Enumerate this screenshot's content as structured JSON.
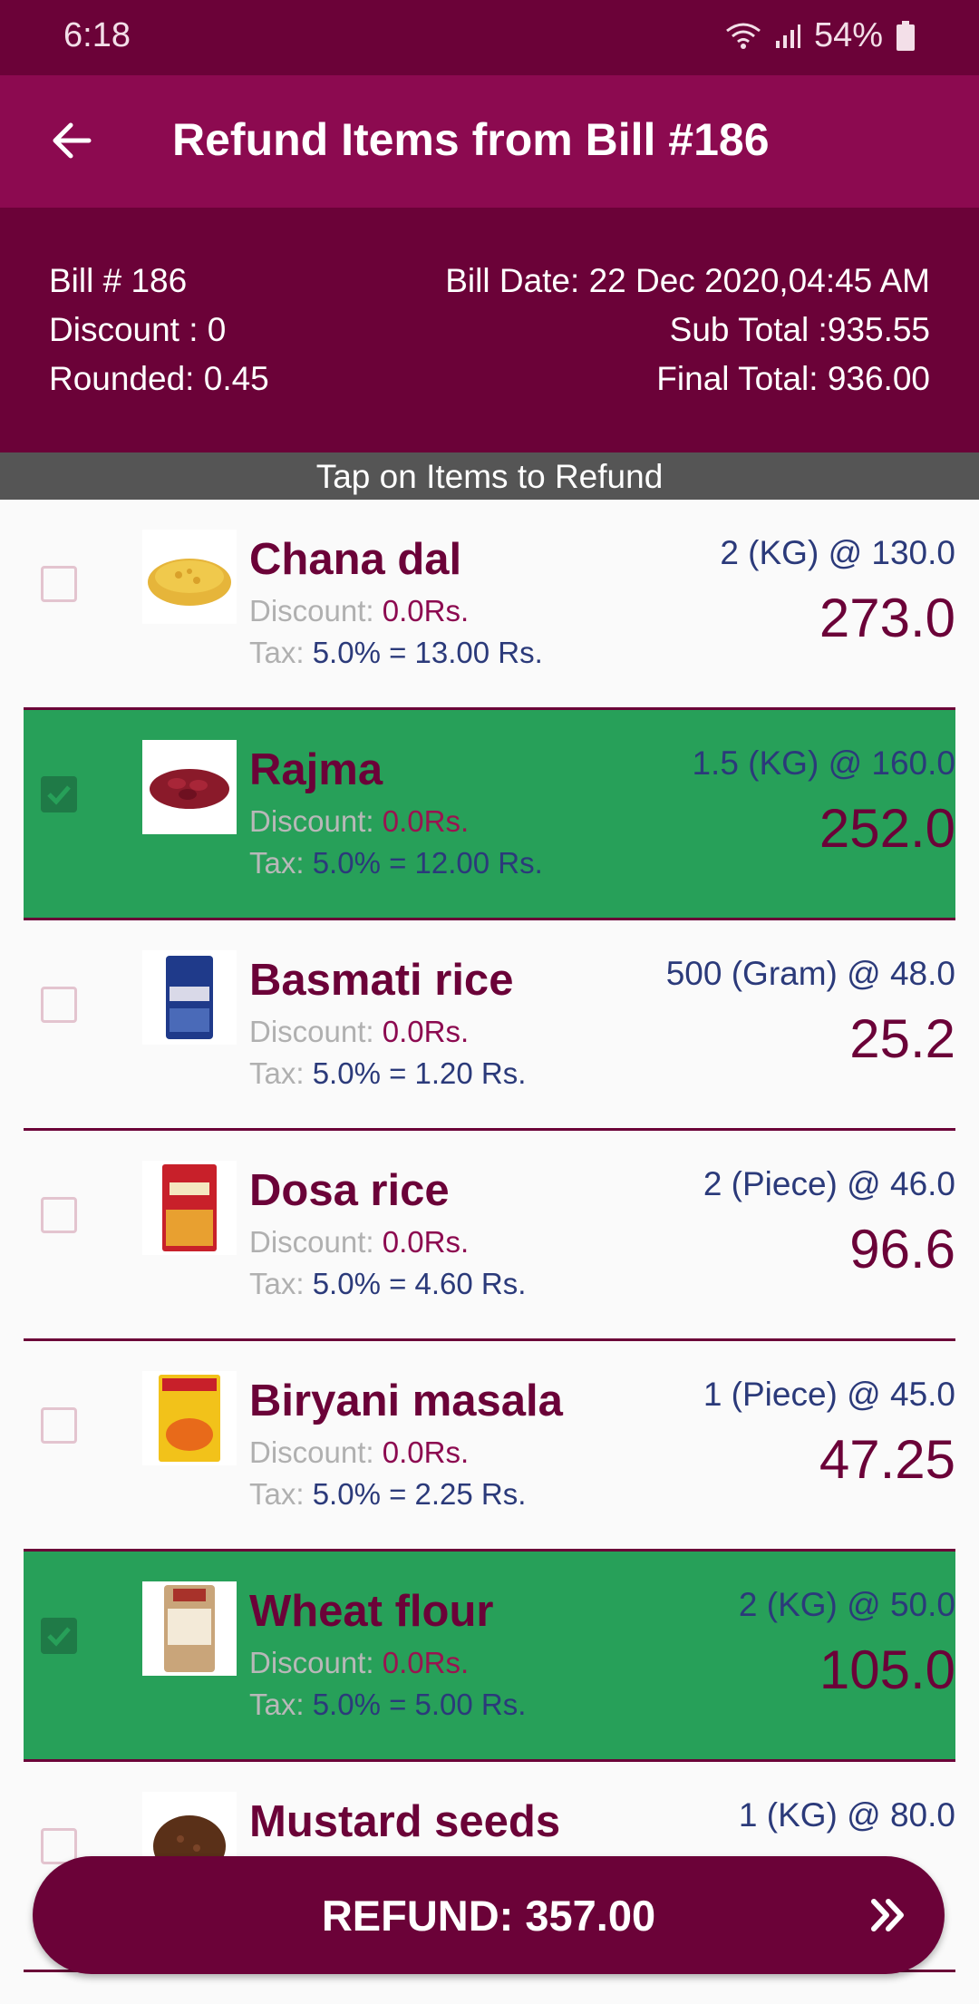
{
  "status": {
    "time": "6:18",
    "battery": "54%"
  },
  "appbar": {
    "title": "Refund Items from Bill #186"
  },
  "bill": {
    "number": "Bill # 186",
    "discount": "Discount : 0",
    "rounded": "Rounded: 0.45",
    "date": "Bill Date: 22 Dec 2020,04:45 AM",
    "subtotal": "Sub Total :935.55",
    "final_total": "Final Total: 936.00"
  },
  "banner": "Tap on Items to Refund",
  "items": [
    {
      "name": "Chana dal",
      "qty": "2 (KG)  @ 130.0",
      "total": "273.0",
      "discount_label": "Discount: ",
      "discount_value": "0.0Rs.",
      "tax_label": "Tax: ",
      "tax_value": "5.0% = 13.00 Rs.",
      "selected": false
    },
    {
      "name": "Rajma",
      "qty": "1.5 (KG)  @ 160.0",
      "total": "252.0",
      "discount_label": "Discount: ",
      "discount_value": "0.0Rs.",
      "tax_label": "Tax: ",
      "tax_value": "5.0% = 12.00 Rs.",
      "selected": true
    },
    {
      "name": "Basmati rice",
      "qty": "500 (Gram)  @ 48.0",
      "total": "25.2",
      "discount_label": "Discount: ",
      "discount_value": "0.0Rs.",
      "tax_label": "Tax: ",
      "tax_value": "5.0% = 1.20 Rs.",
      "selected": false
    },
    {
      "name": "Dosa rice",
      "qty": "2 (Piece)  @ 46.0",
      "total": "96.6",
      "discount_label": "Discount: ",
      "discount_value": "0.0Rs.",
      "tax_label": "Tax: ",
      "tax_value": "5.0% = 4.60 Rs.",
      "selected": false
    },
    {
      "name": "Biryani masala",
      "qty": "1 (Piece)  @ 45.0",
      "total": "47.25",
      "discount_label": "Discount: ",
      "discount_value": "0.0Rs.",
      "tax_label": "Tax: ",
      "tax_value": "5.0% = 2.25 Rs.",
      "selected": false
    },
    {
      "name": "Wheat flour",
      "qty": "2 (KG)  @ 50.0",
      "total": "105.0",
      "discount_label": "Discount: ",
      "discount_value": "0.0Rs.",
      "tax_label": "Tax: ",
      "tax_value": "5.0% = 5.00 Rs.",
      "selected": true
    },
    {
      "name": "Mustard seeds",
      "qty": "1 (KG)  @ 80.0",
      "total": "",
      "discount_label": "",
      "discount_value": "",
      "tax_label": "",
      "tax_value": "",
      "selected": false
    }
  ],
  "refund_button": {
    "label": "REFUND: 357.00"
  },
  "colors": {
    "primary_dark": "#6b0238",
    "primary": "#8c0a50",
    "selected": "#27a059",
    "accent_text": "#2b3a7a"
  }
}
